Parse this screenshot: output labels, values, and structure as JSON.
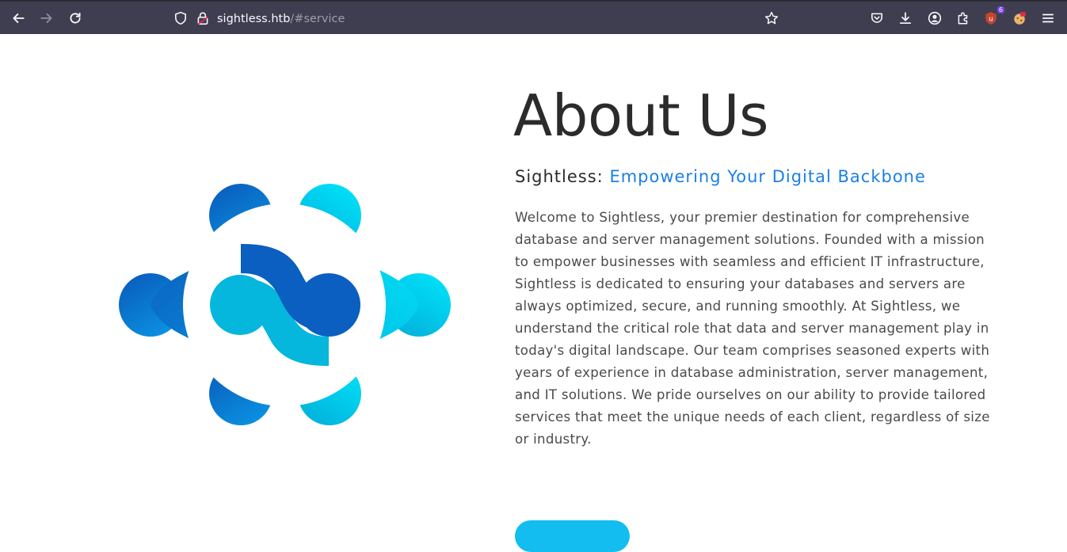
{
  "browser": {
    "url_host": "sightless.htb",
    "url_path": "/#service",
    "extension_badge": "6"
  },
  "about": {
    "title": "About Us",
    "subtitle_prefix": "Sightless: ",
    "subtitle_accent": "Empowering Your Digital Backbone",
    "paragraph": "Welcome to Sightless, your premier destination for comprehensive database and server management solutions. Founded with a mission to empower businesses with seamless and efficient IT infrastructure, Sightless is dedicated to ensuring your databases and servers are always optimized, secure, and running smoothly. At Sightless, we understand the critical role that data and server management play in today's digital landscape. Our team comprises seasoned experts with years of experience in database administration, server management, and IT solutions. We pride ourselves on our ability to provide tailored services that meet the unique needs of each client, regardless of size or industry."
  },
  "icons": {
    "back": "back-arrow-icon",
    "forward": "forward-arrow-icon",
    "reload": "reload-icon",
    "shield": "tracking-protection-shield-icon",
    "lock": "connection-lock-icon",
    "bookmark": "bookmark-star-icon",
    "pocket": "pocket-icon",
    "downloads": "download-icon",
    "account": "account-icon",
    "extensions": "extensions-puzzle-icon",
    "ublock": "ublock-extension-icon",
    "cookie": "cookie-extension-icon",
    "menu": "hamburger-menu-icon"
  },
  "colors": {
    "toolbar_bg": "#3f3e51",
    "accent_blue": "#1a80e5",
    "logo_dark_blue": "#0a5fc0",
    "logo_cyan": "#00e1fa",
    "cta_button": "#13bdf0"
  }
}
